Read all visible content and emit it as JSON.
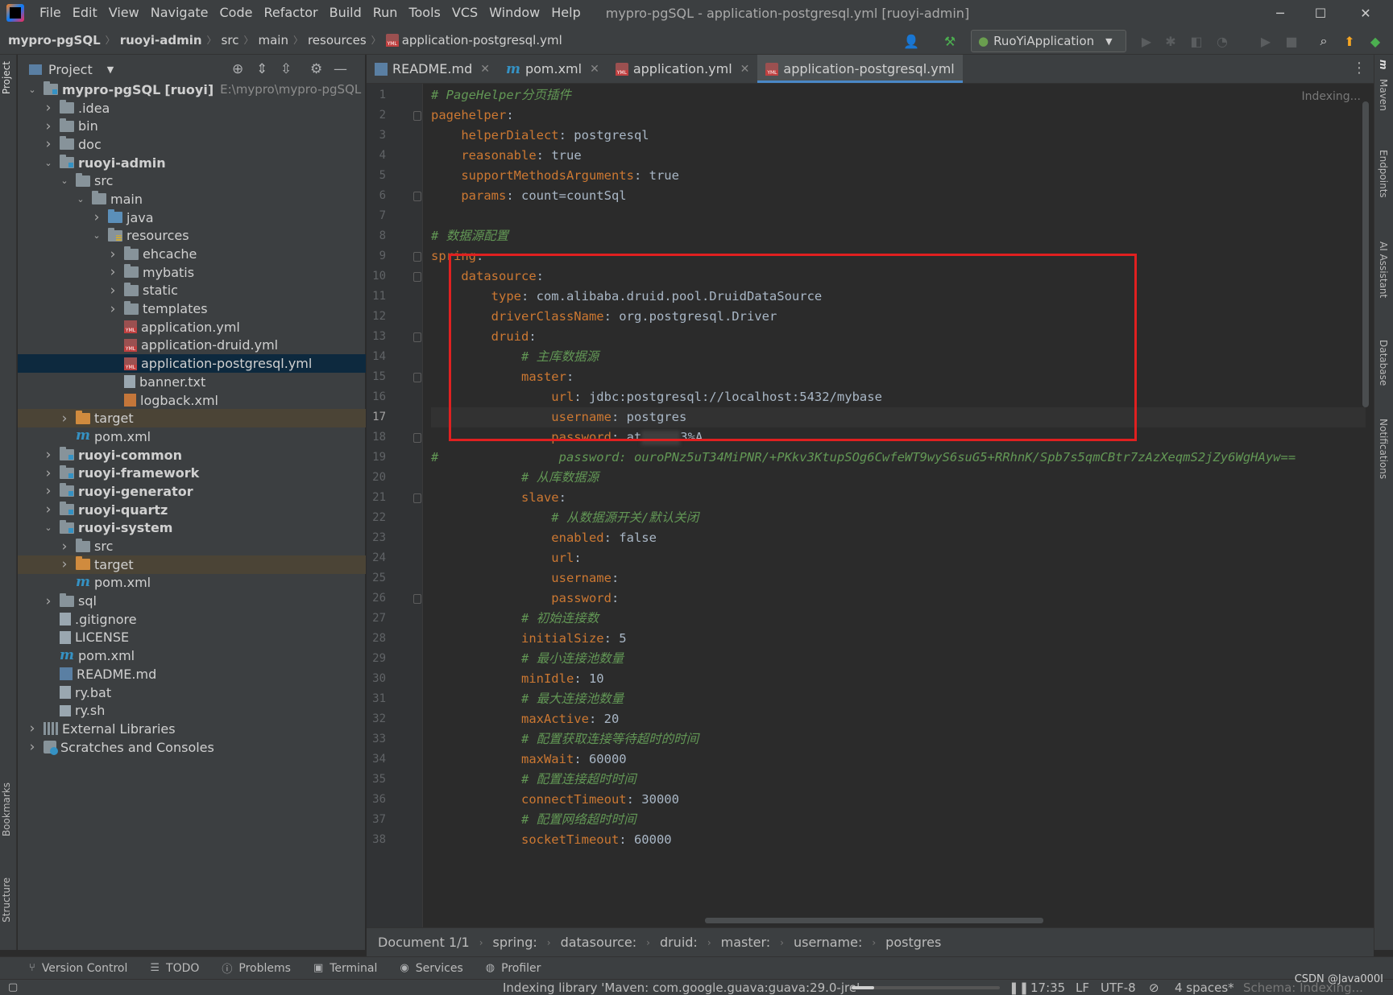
{
  "menu": [
    "File",
    "Edit",
    "View",
    "Navigate",
    "Code",
    "Refactor",
    "Build",
    "Run",
    "Tools",
    "VCS",
    "Window",
    "Help"
  ],
  "window_title": "mypro-pgSQL - application-postgresql.yml [ruoyi-admin]",
  "navbar": {
    "crumbs": [
      "mypro-pgSQL",
      "ruoyi-admin",
      "src",
      "main",
      "resources",
      "application-postgresql.yml"
    ],
    "run_config": "RuoYiApplication"
  },
  "left_strip": {
    "project": "Project",
    "bookmarks": "Bookmarks",
    "structure": "Structure"
  },
  "right_strip": {
    "maven": "Maven",
    "endpoints": "Endpoints",
    "ai": "AI Assistant",
    "database": "Database",
    "notifications": "Notifications"
  },
  "project_panel": {
    "title": "Project"
  },
  "tree": [
    {
      "label": "mypro-pgSQL",
      "suffix": "[ruoyi]",
      "path": "E:\\mypro\\mypro-pgSQL",
      "depth": 0,
      "arrow": "down",
      "icon": "folder module",
      "bold": true
    },
    {
      "label": ".idea",
      "depth": 1,
      "arrow": "right",
      "icon": "folder"
    },
    {
      "label": "bin",
      "depth": 1,
      "arrow": "right",
      "icon": "folder"
    },
    {
      "label": "doc",
      "depth": 1,
      "arrow": "right",
      "icon": "folder"
    },
    {
      "label": "ruoyi-admin",
      "depth": 1,
      "arrow": "down",
      "icon": "folder module",
      "bold": true
    },
    {
      "label": "src",
      "depth": 2,
      "arrow": "down",
      "icon": "folder"
    },
    {
      "label": "main",
      "depth": 3,
      "arrow": "down",
      "icon": "folder"
    },
    {
      "label": "java",
      "depth": 4,
      "arrow": "right",
      "icon": "folder src"
    },
    {
      "label": "resources",
      "depth": 4,
      "arrow": "down",
      "icon": "folder res"
    },
    {
      "label": "ehcache",
      "depth": 5,
      "arrow": "right",
      "icon": "folder"
    },
    {
      "label": "mybatis",
      "depth": 5,
      "arrow": "right",
      "icon": "folder"
    },
    {
      "label": "static",
      "depth": 5,
      "arrow": "right",
      "icon": "folder"
    },
    {
      "label": "templates",
      "depth": 5,
      "arrow": "right",
      "icon": "folder"
    },
    {
      "label": "application.yml",
      "depth": 5,
      "arrow": "none",
      "icon": "file-yml"
    },
    {
      "label": "application-druid.yml",
      "depth": 5,
      "arrow": "none",
      "icon": "file-yml"
    },
    {
      "label": "application-postgresql.yml",
      "depth": 5,
      "arrow": "none",
      "icon": "file-yml",
      "state": "selected"
    },
    {
      "label": "banner.txt",
      "depth": 5,
      "arrow": "none",
      "icon": "file-txt"
    },
    {
      "label": "logback.xml",
      "depth": 5,
      "arrow": "none",
      "icon": "file-xml"
    },
    {
      "label": "target",
      "depth": 2,
      "arrow": "right",
      "icon": "folder target",
      "state": "excluded"
    },
    {
      "label": "pom.xml",
      "depth": 2,
      "arrow": "none",
      "icon": "file-m"
    },
    {
      "label": "ruoyi-common",
      "depth": 1,
      "arrow": "right",
      "icon": "folder module",
      "bold": true
    },
    {
      "label": "ruoyi-framework",
      "depth": 1,
      "arrow": "right",
      "icon": "folder module",
      "bold": true
    },
    {
      "label": "ruoyi-generator",
      "depth": 1,
      "arrow": "right",
      "icon": "folder module",
      "bold": true
    },
    {
      "label": "ruoyi-quartz",
      "depth": 1,
      "arrow": "right",
      "icon": "folder module",
      "bold": true
    },
    {
      "label": "ruoyi-system",
      "depth": 1,
      "arrow": "down",
      "icon": "folder module",
      "bold": true
    },
    {
      "label": "src",
      "depth": 2,
      "arrow": "right",
      "icon": "folder"
    },
    {
      "label": "target",
      "depth": 2,
      "arrow": "right",
      "icon": "folder target",
      "state": "excluded"
    },
    {
      "label": "pom.xml",
      "depth": 2,
      "arrow": "none",
      "icon": "file-m"
    },
    {
      "label": "sql",
      "depth": 1,
      "arrow": "right",
      "icon": "folder"
    },
    {
      "label": ".gitignore",
      "depth": 1,
      "arrow": "none",
      "icon": "file-txt"
    },
    {
      "label": "LICENSE",
      "depth": 1,
      "arrow": "none",
      "icon": "file-txt"
    },
    {
      "label": "pom.xml",
      "depth": 1,
      "arrow": "none",
      "icon": "file-m"
    },
    {
      "label": "README.md",
      "depth": 1,
      "arrow": "none",
      "icon": "file-md"
    },
    {
      "label": "ry.bat",
      "depth": 1,
      "arrow": "none",
      "icon": "file-bat"
    },
    {
      "label": "ry.sh",
      "depth": 1,
      "arrow": "none",
      "icon": "file-sh"
    },
    {
      "label": "External Libraries",
      "depth": 0,
      "arrow": "right",
      "icon": "file-lib"
    },
    {
      "label": "Scratches and Consoles",
      "depth": 0,
      "arrow": "right",
      "icon": "file-scratch"
    }
  ],
  "tabs": [
    {
      "label": "README.md",
      "icon": "md"
    },
    {
      "label": "pom.xml",
      "icon": "m"
    },
    {
      "label": "application.yml",
      "icon": "yml"
    },
    {
      "label": "application-postgresql.yml",
      "icon": "yml",
      "active": true
    }
  ],
  "editor": {
    "indexing": "Indexing...",
    "current_line": 17,
    "lines": [
      [
        {
          "t": "# PageHelper分页插件",
          "c": "c"
        }
      ],
      [
        {
          "t": "pagehelper",
          "c": "k"
        },
        {
          "t": ":",
          "c": "v"
        }
      ],
      [
        {
          "t": "    helperDialect",
          "c": "k"
        },
        {
          "t": ": postgresql",
          "c": "v"
        }
      ],
      [
        {
          "t": "    reasonable",
          "c": "k"
        },
        {
          "t": ": true",
          "c": "v"
        }
      ],
      [
        {
          "t": "    supportMethodsArguments",
          "c": "k"
        },
        {
          "t": ": true",
          "c": "v"
        }
      ],
      [
        {
          "t": "    params",
          "c": "k"
        },
        {
          "t": ": count=countSql",
          "c": "v"
        }
      ],
      [],
      [
        {
          "t": "# 数据源配置",
          "c": "c"
        }
      ],
      [
        {
          "t": "spring",
          "c": "k"
        },
        {
          "t": ":",
          "c": "v"
        }
      ],
      [
        {
          "t": "    datasource",
          "c": "k"
        },
        {
          "t": ":",
          "c": "v"
        }
      ],
      [
        {
          "t": "        type",
          "c": "k"
        },
        {
          "t": ": com.alibaba.druid.pool.DruidDataSource",
          "c": "v"
        }
      ],
      [
        {
          "t": "        driverClassName",
          "c": "k"
        },
        {
          "t": ": org.postgresql.Driver",
          "c": "v"
        }
      ],
      [
        {
          "t": "        druid",
          "c": "k"
        },
        {
          "t": ":",
          "c": "v"
        }
      ],
      [
        {
          "t": "            # 主库数据源",
          "c": "c"
        }
      ],
      [
        {
          "t": "            master",
          "c": "k"
        },
        {
          "t": ":",
          "c": "v"
        }
      ],
      [
        {
          "t": "                url",
          "c": "k"
        },
        {
          "t": ": jdbc:postgresql://localhost:5432/mybase",
          "c": "v"
        }
      ],
      [
        {
          "t": "                username",
          "c": "k"
        },
        {
          "t": ": postgres",
          "c": "v"
        }
      ],
      [
        {
          "t": "                password",
          "c": "k"
        },
        {
          "t": ": at",
          "c": "v"
        },
        {
          "t": "",
          "c": "blur"
        },
        {
          "t": "3%A",
          "c": "v"
        }
      ],
      [
        {
          "t": "#                password: ouroPNz5uT34MiPNR/+PKkv3KtupSOg6CwfeWT9wyS6suG5+RRhnK/Spb7s5qmCBtr7zAzXeqmS2jZy6WgHAyw==",
          "c": "c"
        }
      ],
      [
        {
          "t": "            # 从库数据源",
          "c": "c"
        }
      ],
      [
        {
          "t": "            slave",
          "c": "k"
        },
        {
          "t": ":",
          "c": "v"
        }
      ],
      [
        {
          "t": "                # 从数据源开关/默认关闭",
          "c": "c"
        }
      ],
      [
        {
          "t": "                enabled",
          "c": "k"
        },
        {
          "t": ": false",
          "c": "v"
        }
      ],
      [
        {
          "t": "                url",
          "c": "k"
        },
        {
          "t": ":",
          "c": "v"
        }
      ],
      [
        {
          "t": "                username",
          "c": "k"
        },
        {
          "t": ":",
          "c": "v"
        }
      ],
      [
        {
          "t": "                password",
          "c": "k"
        },
        {
          "t": ":",
          "c": "v"
        }
      ],
      [
        {
          "t": "            # 初始连接数",
          "c": "c"
        }
      ],
      [
        {
          "t": "            initialSize",
          "c": "k"
        },
        {
          "t": ": 5",
          "c": "v"
        }
      ],
      [
        {
          "t": "            # 最小连接池数量",
          "c": "c"
        }
      ],
      [
        {
          "t": "            minIdle",
          "c": "k"
        },
        {
          "t": ": 10",
          "c": "v"
        }
      ],
      [
        {
          "t": "            # 最大连接池数量",
          "c": "c"
        }
      ],
      [
        {
          "t": "            maxActive",
          "c": "k"
        },
        {
          "t": ": 20",
          "c": "v"
        }
      ],
      [
        {
          "t": "            # 配置获取连接等待超时的时间",
          "c": "c"
        }
      ],
      [
        {
          "t": "            maxWait",
          "c": "k"
        },
        {
          "t": ": 60000",
          "c": "v"
        }
      ],
      [
        {
          "t": "            # 配置连接超时时间",
          "c": "c"
        }
      ],
      [
        {
          "t": "            connectTimeout",
          "c": "k"
        },
        {
          "t": ": 30000",
          "c": "v"
        }
      ],
      [
        {
          "t": "            # 配置网络超时时间",
          "c": "c"
        }
      ],
      [
        {
          "t": "            socketTimeout",
          "c": "k"
        },
        {
          "t": ": 60000",
          "c": "v"
        }
      ]
    ],
    "fold_lines": [
      2,
      6,
      9,
      10,
      13,
      15,
      18,
      21,
      26
    ]
  },
  "editor_crumbs": [
    "Document 1/1",
    "spring:",
    "datasource:",
    "druid:",
    "master:",
    "username:",
    "postgres"
  ],
  "bottom_tools": [
    {
      "label": "Version Control",
      "icon": "branch-icon"
    },
    {
      "label": "TODO",
      "icon": "list-icon"
    },
    {
      "label": "Problems",
      "icon": "info-icon"
    },
    {
      "label": "Terminal",
      "icon": "terminal-icon"
    },
    {
      "label": "Services",
      "icon": "services-icon"
    },
    {
      "label": "Profiler",
      "icon": "profiler-icon"
    }
  ],
  "status": {
    "indexing_text": "Indexing library 'Maven: com.google.guava:guava:29.0-jre'",
    "progress_fraction": 0.15,
    "position": "17:35",
    "line_sep": "LF",
    "encoding": "UTF-8",
    "indent": "4 spaces*",
    "schema": "Schema: Indexing...",
    "watermark": "CSDN @Java000I"
  },
  "colors": {
    "accent": "#4a88c7",
    "keyword": "#cc7832",
    "comment": "#629755",
    "highlight_box": "#e02020"
  }
}
